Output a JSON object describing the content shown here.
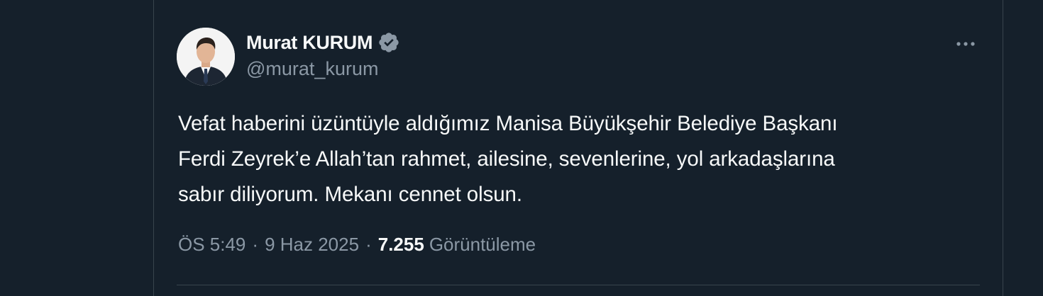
{
  "tweet": {
    "author": {
      "display_name": "Murat KURUM",
      "handle": "@murat_kurum",
      "verified": true,
      "verified_icon": "verified-badge-icon",
      "avatar_icon": "avatar-photo"
    },
    "more_icon": "more-horizontal-icon",
    "text_lines": [
      "Vefat haberini üzüntüyle aldığımız Manisa Büyükşehir Belediye Başkanı",
      "Ferdi Zeyrek’e Allah’tan rahmet, ailesine, sevenlerine, yol arkadaşlarına",
      "sabır diliyorum. Mekanı cennet olsun."
    ],
    "meta": {
      "time": "ÖS 5:49",
      "separator": "·",
      "date": "9 Haz 2025",
      "views_count": "7.255",
      "views_label": "Görüntüleme"
    }
  },
  "colors": {
    "background": "#15202b",
    "border": "#38444d",
    "primary_text": "#f7f9f9",
    "secondary_text": "#8b98a5",
    "verified_badge": "#8b98a5"
  }
}
